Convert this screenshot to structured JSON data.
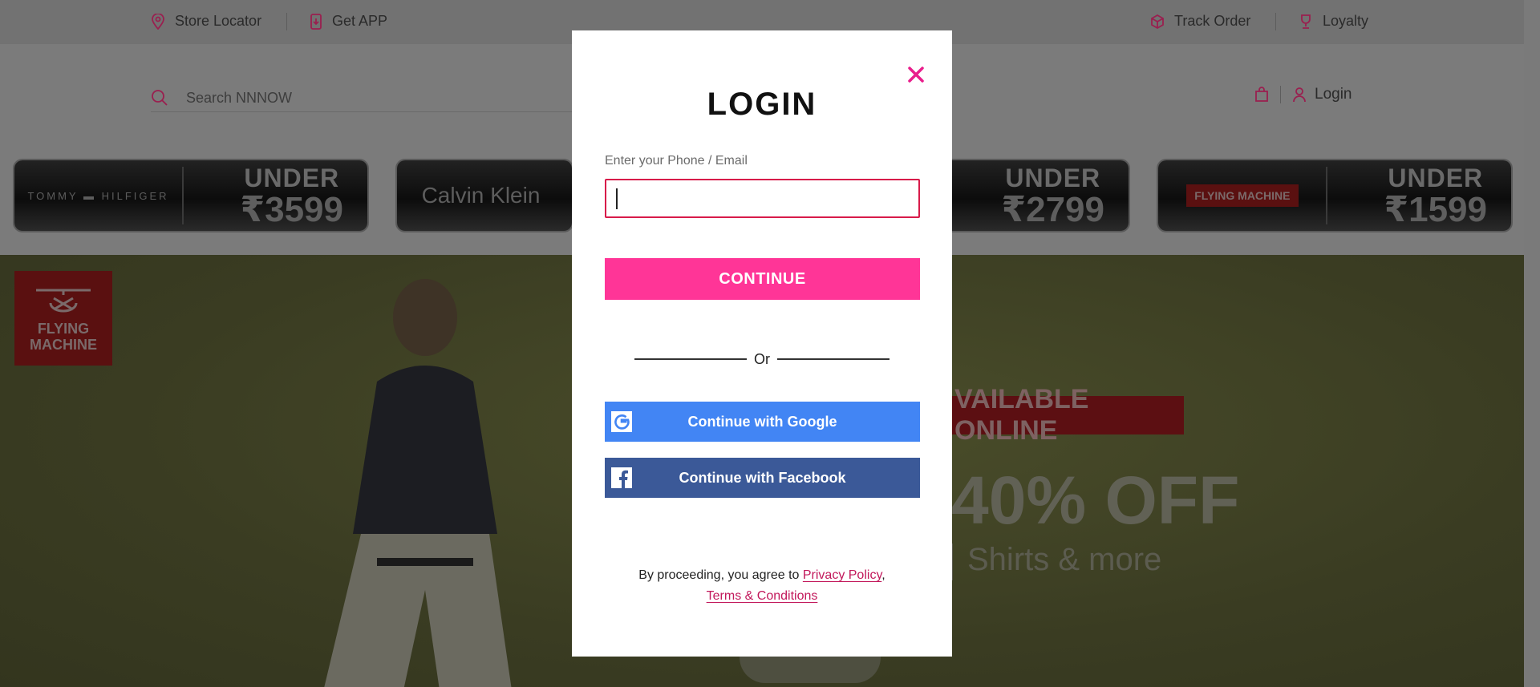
{
  "topbar": {
    "store_locator": "Store Locator",
    "get_app": "Get APP",
    "track_order": "Track Order",
    "loyalty": "Loyalty"
  },
  "header": {
    "search_placeholder": "Search NNNOW",
    "login": "Login"
  },
  "banners": [
    {
      "brand": "TOMMY ▬ HILFIGER",
      "under": "UNDER",
      "price": "₹3599"
    },
    {
      "brand": "Calvin Klein",
      "under": "UNDER",
      "price": ""
    },
    {
      "brand": "",
      "under": "UNDER",
      "price": "₹2799"
    },
    {
      "brand": "FLYING MACHINE",
      "under": "UNDER",
      "price": "₹1599"
    }
  ],
  "hero": {
    "logo_line1": "FLYING",
    "logo_line2": "MACHINE",
    "badge": "VAILABLE ONLINE",
    "discount": "40% OFF",
    "subtitle": "Shirts & more"
  },
  "modal": {
    "title": "LOGIN",
    "field_label": "Enter your Phone / Email",
    "field_value": "",
    "continue": "CONTINUE",
    "or": "Or",
    "google": "Continue with Google",
    "facebook": "Continue with Facebook",
    "legal_prefix": "By proceeding, you agree to ",
    "privacy": "Privacy Policy",
    "legal_comma": ",",
    "terms": "Terms & Conditions"
  },
  "colors": {
    "accent": "#ff3597",
    "error_border": "#d81b4a",
    "google": "#4285f4",
    "facebook": "#3b5998"
  }
}
